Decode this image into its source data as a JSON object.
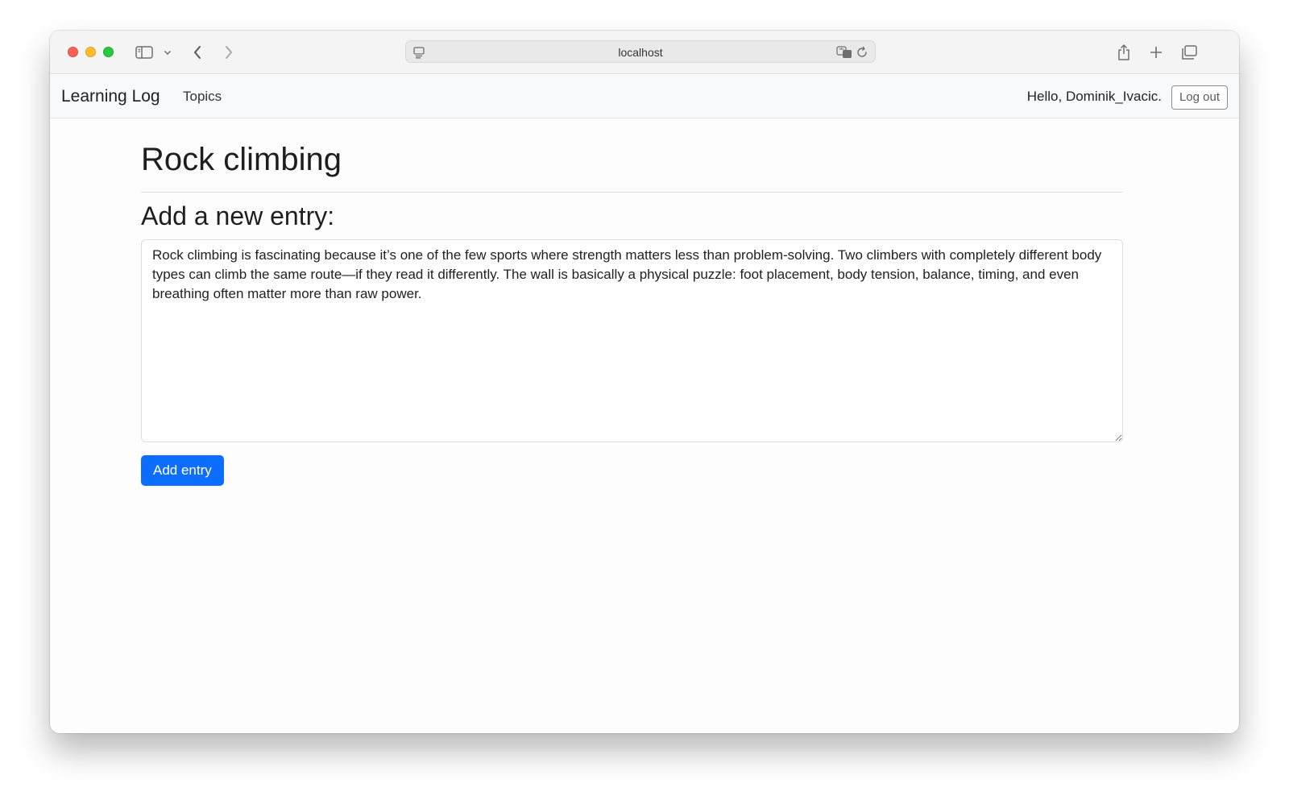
{
  "browser": {
    "url": "localhost"
  },
  "navbar": {
    "brand": "Learning Log",
    "topics_link": "Topics",
    "greeting": "Hello, Dominik_Ivacic.",
    "logout_label": "Log out"
  },
  "main": {
    "topic_title": "Rock climbing",
    "section_title": "Add a new entry:",
    "entry_text": "Rock climbing is fascinating because it’s one of the few sports where strength matters less than problem-solving. Two climbers with completely different body types can climb the same route—if they read it differently. The wall is basically a physical puzzle: foot placement, body tension, balance, timing, and even breathing often matter more than raw power.",
    "submit_label": "Add entry"
  },
  "colors": {
    "primary": "#0d6efd",
    "navbar_bg": "#f8f9fa"
  }
}
